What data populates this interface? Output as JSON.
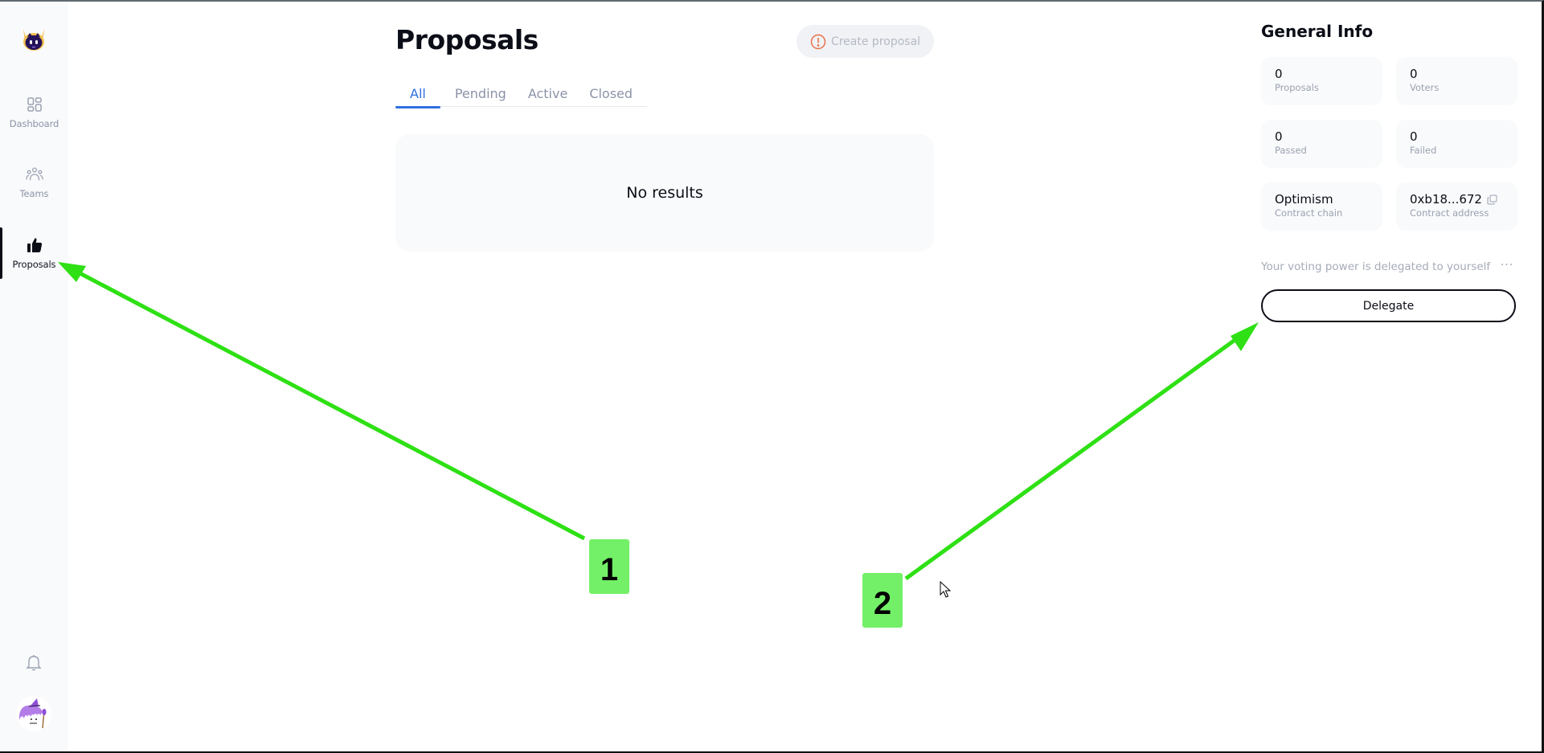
{
  "app": {
    "logo": "bot-mascot-logo"
  },
  "sidebar": {
    "items": [
      {
        "label": "Dashboard",
        "icon": "dashboard-grid-icon",
        "active": false
      },
      {
        "label": "Teams",
        "icon": "team-people-icon",
        "active": false
      },
      {
        "label": "Proposals",
        "icon": "thumbs-up-icon",
        "active": true
      }
    ],
    "notifications_icon": "bell-icon",
    "avatar": "wizard-avatar"
  },
  "main": {
    "title": "Proposals",
    "create_button": {
      "label": "Create proposal",
      "icon": "alert-circle-icon",
      "disabled": true
    },
    "tabs": [
      {
        "label": "All",
        "active": true
      },
      {
        "label": "Pending",
        "active": false
      },
      {
        "label": "Active",
        "active": false
      },
      {
        "label": "Closed",
        "active": false
      }
    ],
    "empty_state": "No results"
  },
  "general_info": {
    "title": "General Info",
    "stats": [
      {
        "value": "0",
        "label": "Proposals"
      },
      {
        "value": "0",
        "label": "Voters"
      },
      {
        "value": "0",
        "label": "Passed"
      },
      {
        "value": "0",
        "label": "Failed"
      },
      {
        "value": "Optimism",
        "label": "Contract chain"
      },
      {
        "value": "0xb18...672",
        "label": "Contract address",
        "icon": "copy-icon"
      }
    ],
    "voting_power_text": "Your voting power is delegated to yourself",
    "more_label": "···",
    "delegate_button": "Delegate"
  },
  "annotations": {
    "color": "#2ee014",
    "markers": [
      {
        "label": "1",
        "target": "sidebar-item-proposals"
      },
      {
        "label": "2",
        "target": "delegate-button"
      }
    ]
  },
  "colors": {
    "accent": "#2f6fe0",
    "warning": "#e8704a",
    "sidebar_bg": "#f9fafb",
    "marker_bg": "#73f068"
  }
}
